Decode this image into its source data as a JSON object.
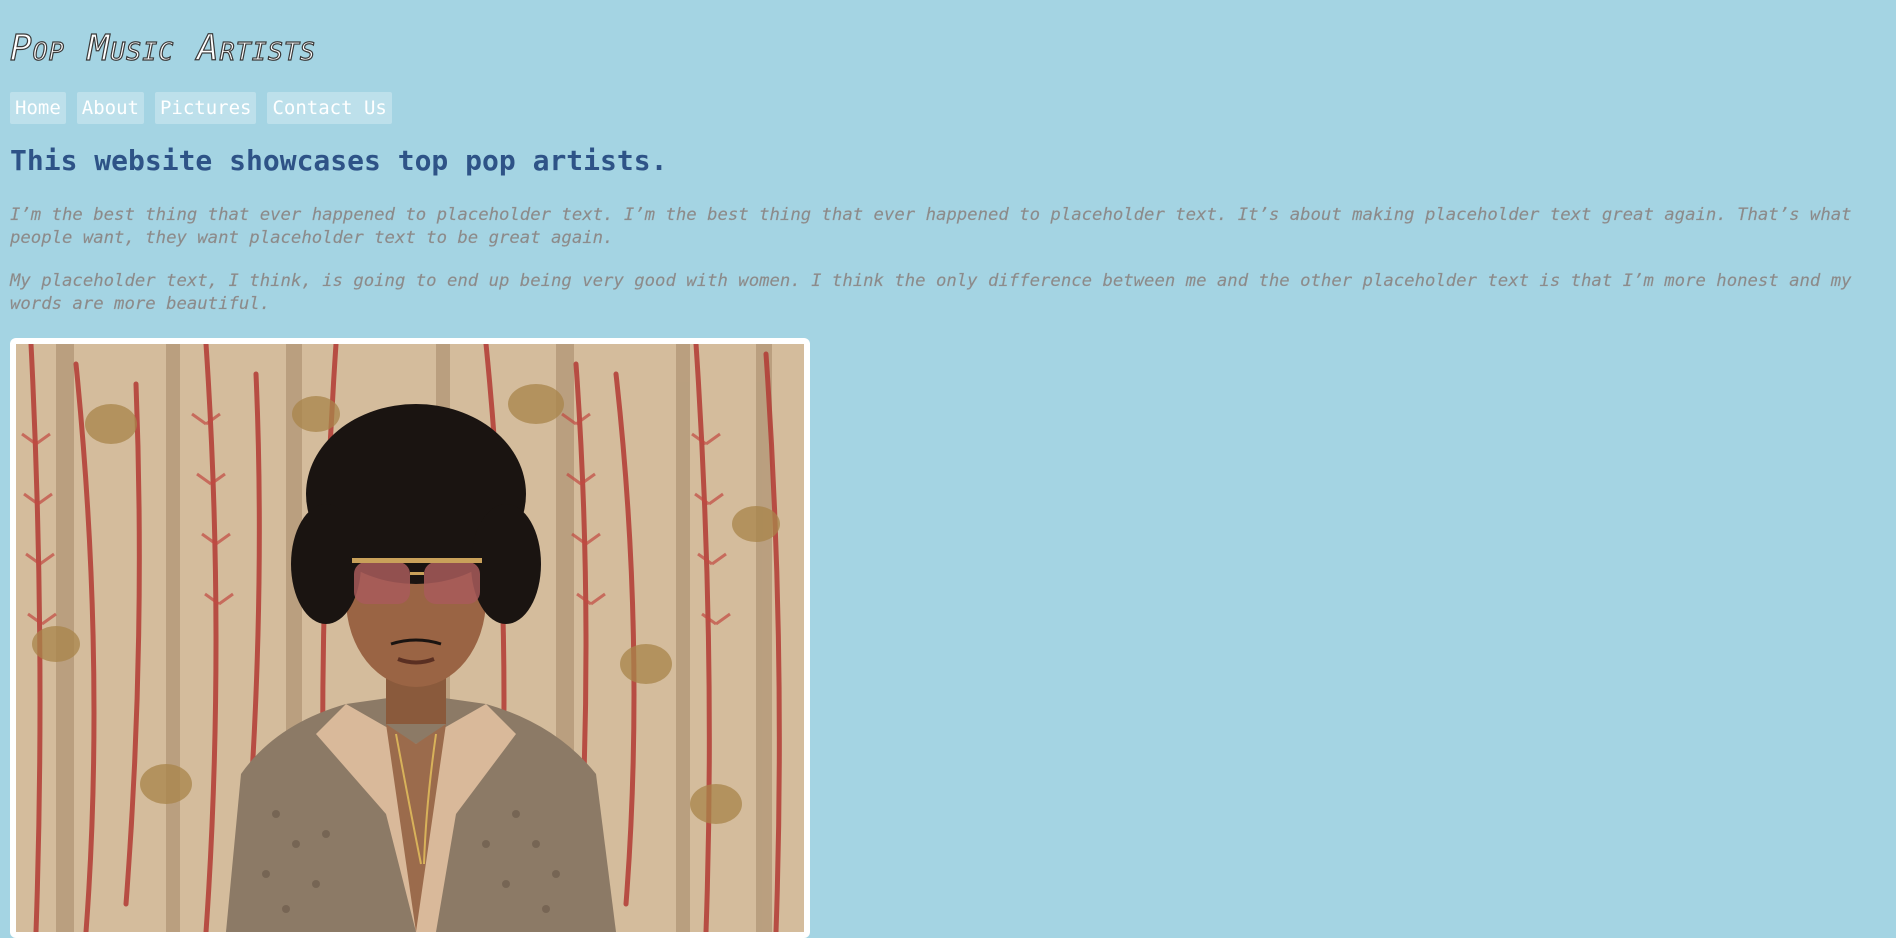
{
  "site": {
    "title": "Pop Music Artists"
  },
  "nav": {
    "items": [
      {
        "label": "Home"
      },
      {
        "label": "About"
      },
      {
        "label": "Pictures"
      },
      {
        "label": "Contact Us"
      }
    ]
  },
  "main": {
    "headline": "This website showcases top pop artists.",
    "paragraphs": [
      "I’m the best thing that ever happened to placeholder text. I’m the best thing that ever happened to placeholder text. It’s about making placeholder text great again. That’s what people want, they want placeholder text to be great again.",
      "My placeholder text, I think, is going to end up being very good with women. I think the only difference between me and the other placeholder text is that I’m more honest and my words are more beautiful."
    ]
  },
  "colors": {
    "background": "#a4d4e3",
    "headline": "#2e5387",
    "body_text": "#8a8a8a",
    "nav_bg": "rgba(255,255,255,0.28)"
  },
  "icons": {
    "photo": "artist-portrait-image"
  }
}
